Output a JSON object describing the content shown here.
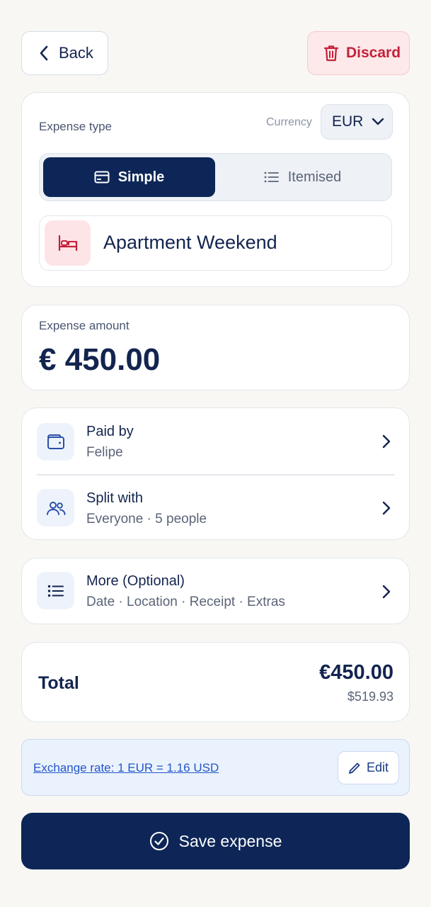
{
  "header": {
    "back_label": "Back",
    "discard_label": "Discard"
  },
  "expense_type": {
    "label": "Expense type",
    "currency_label": "Currency",
    "currency_value": "EUR",
    "segments": {
      "simple": "Simple",
      "itemised": "Itemised",
      "selected": "simple"
    },
    "category_icon": "bed-icon",
    "category_name": "Apartment Weekend"
  },
  "amount": {
    "label": "Expense amount",
    "value": "€ 450.00"
  },
  "paid_by": {
    "icon": "wallet-icon",
    "title": "Paid by",
    "value": "Felipe"
  },
  "split_with": {
    "icon": "people-icon",
    "title": "Split with",
    "value": "Everyone · 5 people"
  },
  "more": {
    "icon": "list-icon",
    "title": "More (Optional)",
    "value": "Date · Location · Receipt · Extras"
  },
  "total": {
    "label": "Total",
    "eur": "€450.00",
    "usd": "$519.93"
  },
  "exchange": {
    "rate_text": "Exchange rate: 1 EUR = 1.16 USD",
    "edit_label": "Edit"
  },
  "save_label": "Save expense",
  "colors": {
    "primary": "#0d2657",
    "danger": "#c4213a",
    "link": "#2456c9",
    "background": "#f8f7f3"
  }
}
